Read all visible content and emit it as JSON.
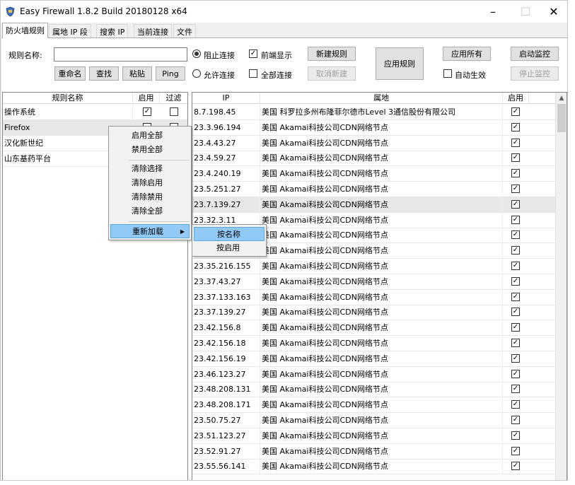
{
  "app": {
    "title": "Easy Firewall 1.8.2 Build 20180128 x64",
    "minimize": "–",
    "maximize": "☐",
    "close": "✕"
  },
  "tabs": [
    {
      "label": "防火墙规则",
      "active": true
    },
    {
      "label": "属地 IP 段",
      "active": false
    },
    {
      "label": "搜索 IP",
      "active": false
    },
    {
      "label": "当前连接",
      "active": false
    },
    {
      "label": "文件",
      "active": false
    }
  ],
  "toolbar": {
    "rule_name_label": "规则名称:",
    "rule_name_value": "",
    "rename": "重命名",
    "find": "查找",
    "paste": "粘贴",
    "ping": "Ping",
    "block_label": "阻止连接",
    "allow_label": "允许连接",
    "front_label": "前端显示",
    "all_conn_label": "全部连接",
    "new_rule": "新建规则",
    "cancel_new": "取消新建",
    "apply_rule": "应用规则",
    "apply_all": "应用所有",
    "auto_effect": "自动生效",
    "start_monitor": "启动监控",
    "stop_monitor": "停止监控"
  },
  "rules_grid": {
    "headers": [
      "规则名称",
      "启用",
      "过滤"
    ],
    "rows": [
      {
        "name": "操作系统",
        "enabled": true,
        "filter": false
      },
      {
        "name": "Firefox",
        "enabled": false,
        "filter": false
      },
      {
        "name": "汉化新世纪",
        "enabled": false,
        "filter": false
      },
      {
        "name": "山东基药平台",
        "enabled": false,
        "filter": false
      }
    ]
  },
  "context_menu": {
    "items": [
      "启用全部",
      "禁用全部",
      "清除选择",
      "清除启用",
      "清除禁用",
      "清除全部",
      "重新加载"
    ],
    "submenu": [
      "按名称",
      "按启用"
    ]
  },
  "ip_grid": {
    "headers": [
      "IP",
      "属地",
      "启用"
    ],
    "rows": [
      {
        "ip": "8.7.198.45",
        "loc": "美国 科罗拉多州布隆菲尔德市Level 3通信股份有限公司",
        "enabled": true
      },
      {
        "ip": "23.3.96.194",
        "loc": "美国 Akamai科技公司CDN网络节点",
        "enabled": true
      },
      {
        "ip": "23.4.43.27",
        "loc": "美国 Akamai科技公司CDN网络节点",
        "enabled": true
      },
      {
        "ip": "23.4.59.27",
        "loc": "美国 Akamai科技公司CDN网络节点",
        "enabled": true
      },
      {
        "ip": "23.4.240.19",
        "loc": "美国 Akamai科技公司CDN网络节点",
        "enabled": true
      },
      {
        "ip": "23.5.251.27",
        "loc": "美国 Akamai科技公司CDN网络节点",
        "enabled": true
      },
      {
        "ip": "23.7.139.27",
        "loc": "美国 Akamai科技公司CDN网络节点",
        "enabled": true
      },
      {
        "ip": "23.32.3.11",
        "loc": "美国 Akamai科技公司CDN网络节点",
        "enabled": true
      },
      {
        "ip": "23.32.5.75",
        "loc": "美国 Akamai科技公司CDN网络节点",
        "enabled": true
      },
      {
        "ip": "23.33.60.153",
        "loc": "美国 Akamai科技公司CDN网络节点",
        "enabled": true
      },
      {
        "ip": "23.35.216.155",
        "loc": "美国 Akamai科技公司CDN网络节点",
        "enabled": true
      },
      {
        "ip": "23.37.43.27",
        "loc": "美国 Akamai科技公司CDN网络节点",
        "enabled": true
      },
      {
        "ip": "23.37.133.163",
        "loc": "美国 Akamai科技公司CDN网络节点",
        "enabled": true
      },
      {
        "ip": "23.37.139.27",
        "loc": "美国 Akamai科技公司CDN网络节点",
        "enabled": true
      },
      {
        "ip": "23.42.156.8",
        "loc": "美国 Akamai科技公司CDN网络节点",
        "enabled": true
      },
      {
        "ip": "23.42.156.18",
        "loc": "美国 Akamai科技公司CDN网络节点",
        "enabled": true
      },
      {
        "ip": "23.42.156.19",
        "loc": "美国 Akamai科技公司CDN网络节点",
        "enabled": true
      },
      {
        "ip": "23.46.123.27",
        "loc": "美国 Akamai科技公司CDN网络节点",
        "enabled": true
      },
      {
        "ip": "23.48.208.131",
        "loc": "美国 Akamai科技公司CDN网络节点",
        "enabled": true
      },
      {
        "ip": "23.48.208.171",
        "loc": "美国 Akamai科技公司CDN网络节点",
        "enabled": true
      },
      {
        "ip": "23.50.75.27",
        "loc": "美国 Akamai科技公司CDN网络节点",
        "enabled": true
      },
      {
        "ip": "23.51.123.27",
        "loc": "美国 Akamai科技公司CDN网络节点",
        "enabled": true
      },
      {
        "ip": "23.52.91.27",
        "loc": "美国 Akamai科技公司CDN网络节点",
        "enabled": true
      },
      {
        "ip": "23.55.56.141",
        "loc": "美国 Akamai科技公司CDN网络节点",
        "enabled": true
      }
    ]
  }
}
